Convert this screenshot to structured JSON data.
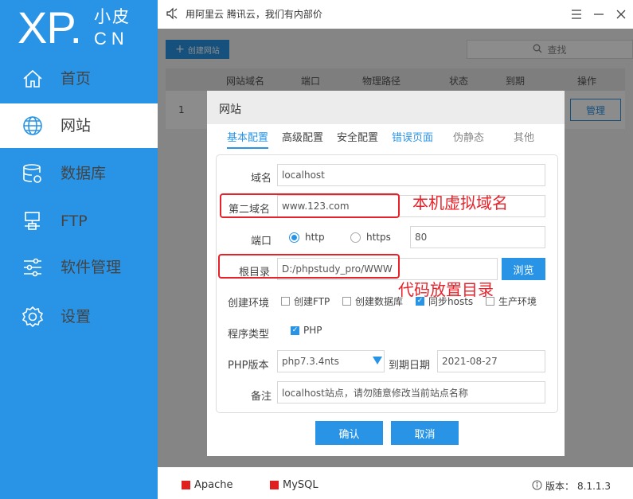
{
  "sidebar": {
    "logo": {
      "main": "XP.",
      "sub_cn": "小皮",
      "sub_en": "CN"
    },
    "items": [
      {
        "label": "首页",
        "icon": "home-icon"
      },
      {
        "label": "网站",
        "icon": "globe-icon"
      },
      {
        "label": "数据库",
        "icon": "database-icon"
      },
      {
        "label": "FTP",
        "icon": "ftp-server-icon"
      },
      {
        "label": "软件管理",
        "icon": "sliders-icon"
      },
      {
        "label": "设置",
        "icon": "gear-icon"
      }
    ],
    "active_index": 1
  },
  "topbar": {
    "notice": "用阿里云 腾讯云，我们有内部价"
  },
  "toolbar": {
    "create_label": "创建网站",
    "search_label": "查找"
  },
  "table": {
    "headers": [
      "网站域名",
      "端口",
      "物理路径",
      "状态",
      "到期",
      "操作"
    ],
    "rows": [
      {
        "num": "1",
        "action": "管理"
      }
    ]
  },
  "dialog": {
    "title": "网站",
    "tabs": [
      "基本配置",
      "高级配置",
      "安全配置",
      "错误页面",
      "伪静态",
      "其他"
    ],
    "active_tab": 0,
    "fields": {
      "domain_label": "域名",
      "domain_value": "localhost",
      "second_domain_label": "第二域名",
      "second_domain_value": "www.123.com",
      "port_label": "端口",
      "http_label": "http",
      "https_label": "https",
      "port_value": "80",
      "root_label": "根目录",
      "root_value": "D:/phpstudy_pro/WWW",
      "browse_label": "浏览",
      "env_label": "创建环境",
      "env_options": [
        "创建FTP",
        "创建数据库",
        "同步hosts",
        "生产环境"
      ],
      "prog_label": "程序类型",
      "prog_option": "PHP",
      "php_label": "PHP版本",
      "php_value": "php7.3.4nts",
      "expire_label": "到期日期",
      "expire_value": "2021-08-27",
      "note_label": "备注",
      "note_value": "localhost站点，请勿随意修改当前站点名称"
    },
    "confirm_label": "确认",
    "cancel_label": "取消"
  },
  "annotations": {
    "domain_note": "本机虚拟域名",
    "root_note": "代码放置目录"
  },
  "statusbar": {
    "services": [
      {
        "name": "Apache",
        "color": "#e02020"
      },
      {
        "name": "MySQL",
        "color": "#e02020"
      }
    ],
    "version_label": "版本：",
    "version_value": "8.1.1.3"
  },
  "colors": {
    "accent": "#2994e6",
    "annotation_red": "#e8222a"
  }
}
